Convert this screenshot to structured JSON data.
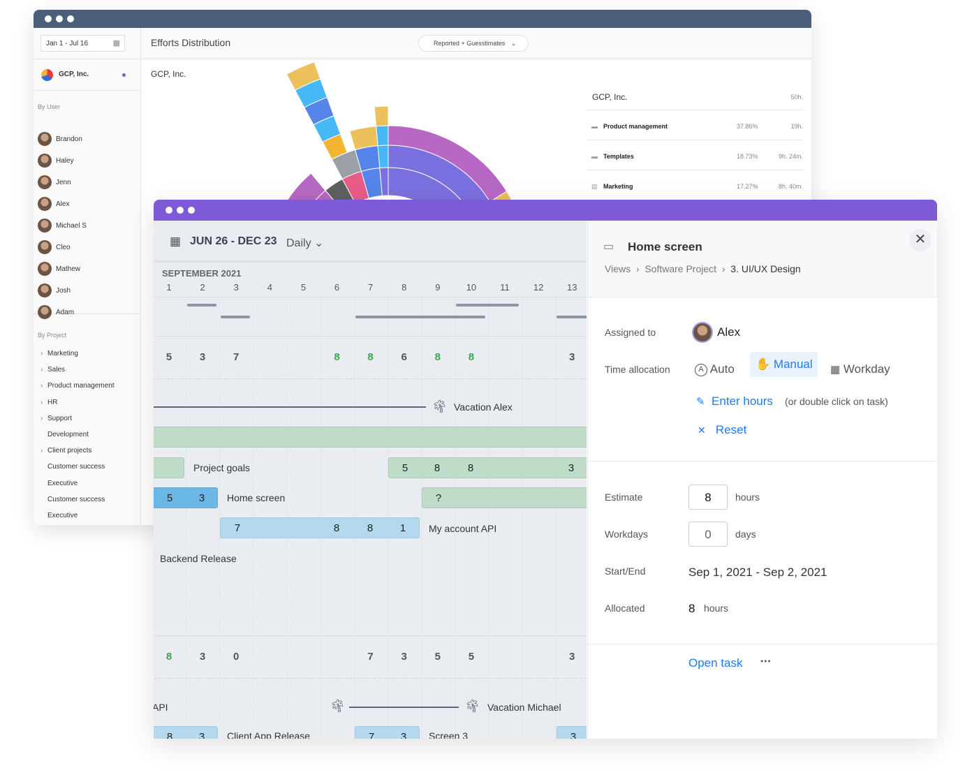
{
  "back_window": {
    "date_range": "Jan 1 - Jul 16",
    "title": "Efforts Distribution",
    "filter": "Reported + Guesstimates",
    "org": "GCP, Inc.",
    "by_user_label": "By User",
    "users": [
      "Brandon",
      "Haley",
      "Jenn",
      "Alex",
      "Michael S",
      "Cleo",
      "Mathew",
      "Josh",
      "Adam"
    ],
    "by_project_label": "By Project",
    "projects": [
      {
        "label": "Marketing",
        "expandable": true
      },
      {
        "label": "Sales",
        "expandable": true
      },
      {
        "label": "Product management",
        "expandable": true
      },
      {
        "label": "HR",
        "expandable": true
      },
      {
        "label": "Support",
        "expandable": true
      },
      {
        "label": "Development",
        "expandable": false
      },
      {
        "label": "Client projects",
        "expandable": true
      },
      {
        "label": "Customer success",
        "expandable": false
      },
      {
        "label": "Executive",
        "expandable": false
      },
      {
        "label": "Customer success",
        "expandable": false
      },
      {
        "label": "Executive",
        "expandable": false
      }
    ],
    "chart_title": "GCP, Inc.",
    "summary": {
      "name": "GCP, Inc.",
      "total": "50h.",
      "rows": [
        {
          "icon": "folder-icon",
          "name": "Product management",
          "pct": "37.86%",
          "time": "19h."
        },
        {
          "icon": "folder-icon",
          "name": "Templates",
          "pct": "18.73%",
          "time": "9h. 24m."
        },
        {
          "icon": "list-icon",
          "name": "Marketing",
          "pct": "17.27%",
          "time": "8h. 40m."
        }
      ]
    }
  },
  "chart_data": {
    "type": "sunburst",
    "colors": {
      "purple": "#b768c4",
      "violet": "#7b70e0",
      "blue": "#5585ea",
      "sky": "#45b8f5",
      "yellow": "#ecc05a",
      "orange": "#f4b533",
      "gray": "#9aa0a6",
      "pink": "#e95c88",
      "dark": "#5f6062"
    }
  },
  "gantt": {
    "range": "JUN 26 - DEC 23",
    "scale": "Daily",
    "month": "SEPTEMBER 2021",
    "days": [
      "1",
      "2",
      "3",
      "4",
      "5",
      "6",
      "7",
      "8",
      "9",
      "10",
      "11",
      "12",
      "13"
    ],
    "row1_hours": [
      "5",
      "3",
      "7",
      "",
      "",
      "8",
      "8",
      "6",
      "8",
      "8",
      "",
      "",
      "3"
    ],
    "row2_hours": [
      "8",
      "3",
      "0",
      "",
      "",
      "",
      "7",
      "3",
      "5",
      "5",
      "",
      "",
      "3"
    ],
    "vacation_alex": "Vacation Alex",
    "vacation_michael": "Vacation Michael",
    "project_goals": "Project goals",
    "project_goals_hours": [
      "5",
      "8",
      "8",
      "3"
    ],
    "home_screen": "Home screen",
    "home_screen_hours": [
      "5",
      "3"
    ],
    "unknown": "?",
    "my_account": "My account API",
    "my_account_hours": [
      "7",
      "8",
      "8",
      "1"
    ],
    "backend_release": "Backend Release",
    "api_fragment": "API",
    "client_app": "Client App Release",
    "client_app_hours": [
      "8",
      "3"
    ],
    "screen3": "Screen 3",
    "screen3_hours": [
      "7",
      "3"
    ],
    "last_hours": "3"
  },
  "detail": {
    "title": "Home screen",
    "breadcrumb": [
      "Views",
      "Software Project",
      "3. UI/UX Design"
    ],
    "assigned_label": "Assigned to",
    "assignee": "Alex",
    "time_label": "Time allocation",
    "modes": [
      "Auto",
      "Manual",
      "Workday"
    ],
    "active_mode": "Manual",
    "enter_hours": "Enter hours",
    "enter_hint": "(or double click on task)",
    "reset": "Reset",
    "estimate_label": "Estimate",
    "estimate": "8",
    "hours": "hours",
    "workdays_label": "Workdays",
    "workdays": "0",
    "days": "days",
    "startend_label": "Start/End",
    "startend": "Sep 1, 2021 - Sep 2, 2021",
    "allocated_label": "Allocated",
    "allocated": "8",
    "allocated_unit": "hours",
    "open_task": "Open task",
    "more": "•••",
    "accent": "#1e7bf2"
  }
}
